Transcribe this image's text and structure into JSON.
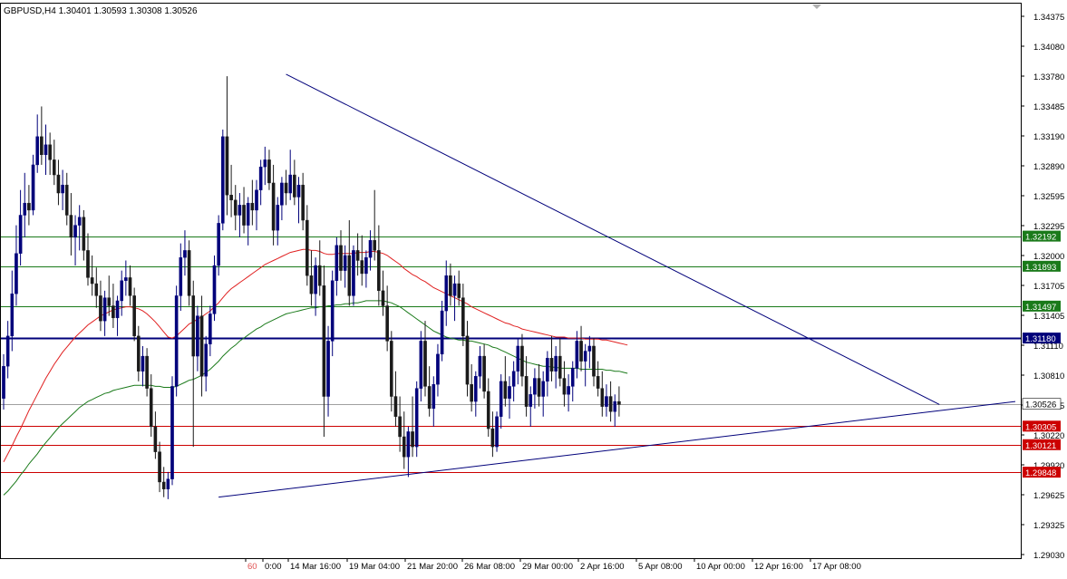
{
  "header": {
    "symbol": "GBPUSD,H4",
    "ohlc": "1.30401 1.30593 1.30308 1.30526"
  },
  "colors": {
    "background": "#ffffff",
    "bull_candle": "#00007a",
    "bear_candle": "#1a1a1a",
    "ma_fast": "#e02020",
    "ma_slow": "#1a7a1a",
    "support_level": "#cc0000",
    "resistance_level": "#1a7a1a",
    "pivot_level": "#00007a",
    "current_price": "#a0a0a0",
    "trendline": "#00007a"
  },
  "chart_data": {
    "type": "candlestick",
    "timeframe": "H4",
    "y_range": [
      1.289,
      1.345
    ],
    "y_ticks": [
      "1.34375",
      "1.34080",
      "1.33780",
      "1.33485",
      "1.33190",
      "1.32890",
      "1.32595",
      "1.32295",
      "1.32000",
      "1.31705",
      "1.31405",
      "1.31110",
      "1.30810",
      "1.30515",
      "1.30220",
      "1.29920",
      "1.29625",
      "1.29325",
      "1.29030"
    ],
    "x_labels": [
      "60",
      "0:00",
      "14 Mar 16:00",
      "19 Mar 04:00",
      "21 Mar 20:00",
      "26 Mar 08:00",
      "29 Mar 00:00",
      "2 Apr 16:00",
      "5 Apr 08:00",
      "10 Apr 00:00",
      "12 Apr 16:00",
      "17 Apr 08:00"
    ],
    "horizontal_levels": [
      {
        "price": 1.32192,
        "label": "1.32192",
        "kind": "resistance"
      },
      {
        "price": 1.31893,
        "label": "1.31893",
        "kind": "resistance"
      },
      {
        "price": 1.31497,
        "label": "1.31497",
        "kind": "resistance"
      },
      {
        "price": 1.3118,
        "label": "1.31180",
        "kind": "pivot"
      },
      {
        "price": 1.30526,
        "label": "1.30526",
        "kind": "current"
      },
      {
        "price": 1.30305,
        "label": "1.30305",
        "kind": "support"
      },
      {
        "price": 1.30121,
        "label": "1.30121",
        "kind": "support"
      },
      {
        "price": 1.29848,
        "label": "1.29848",
        "kind": "support"
      }
    ],
    "trendlines": [
      {
        "name": "descending",
        "from": {
          "bar": 67,
          "price": 1.338
        },
        "to": {
          "bar": 222,
          "price": 1.3052
        }
      },
      {
        "name": "ascending",
        "from": {
          "bar": 51,
          "price": 1.296
        },
        "to": {
          "bar": 240,
          "price": 1.3055
        }
      }
    ],
    "candles": [
      [
        1.3058,
        1.3102,
        1.3047,
        1.309
      ],
      [
        1.309,
        1.3135,
        1.3078,
        1.312
      ],
      [
        1.312,
        1.3185,
        1.3105,
        1.3162
      ],
      [
        1.3162,
        1.323,
        1.315,
        1.3202
      ],
      [
        1.3202,
        1.3265,
        1.319,
        1.324
      ],
      [
        1.324,
        1.3282,
        1.3218,
        1.3252
      ],
      [
        1.3252,
        1.327,
        1.323,
        1.3245
      ],
      [
        1.3245,
        1.33,
        1.324,
        1.329
      ],
      [
        1.329,
        1.334,
        1.3282,
        1.3318
      ],
      [
        1.3318,
        1.3348,
        1.329,
        1.33
      ],
      [
        1.33,
        1.333,
        1.328,
        1.331
      ],
      [
        1.331,
        1.3322,
        1.328,
        1.3295
      ],
      [
        1.3295,
        1.3315,
        1.327,
        1.328
      ],
      [
        1.328,
        1.3295,
        1.325,
        1.3262
      ],
      [
        1.3262,
        1.3285,
        1.3245,
        1.327
      ],
      [
        1.327,
        1.3282,
        1.323,
        1.324
      ],
      [
        1.324,
        1.3262,
        1.32,
        1.3218
      ],
      [
        1.3218,
        1.324,
        1.319,
        1.323
      ],
      [
        1.323,
        1.325,
        1.3205,
        1.3238
      ],
      [
        1.3238,
        1.3245,
        1.3195,
        1.3205
      ],
      [
        1.3205,
        1.3222,
        1.317,
        1.3178
      ],
      [
        1.3178,
        1.32,
        1.316,
        1.3172
      ],
      [
        1.3172,
        1.3188,
        1.3148,
        1.316
      ],
      [
        1.316,
        1.3175,
        1.3125,
        1.3135
      ],
      [
        1.3135,
        1.3165,
        1.312,
        1.3158
      ],
      [
        1.3158,
        1.318,
        1.314,
        1.315
      ],
      [
        1.315,
        1.3172,
        1.3128,
        1.3138
      ],
      [
        1.3138,
        1.316,
        1.312,
        1.3155
      ],
      [
        1.3155,
        1.3185,
        1.314,
        1.3175
      ],
      [
        1.3175,
        1.3195,
        1.316,
        1.3178
      ],
      [
        1.3178,
        1.319,
        1.315,
        1.316
      ],
      [
        1.316,
        1.3168,
        1.3115,
        1.312
      ],
      [
        1.312,
        1.313,
        1.3075,
        1.3085
      ],
      [
        1.3085,
        1.311,
        1.307,
        1.31
      ],
      [
        1.31,
        1.3108,
        1.306,
        1.3068
      ],
      [
        1.3068,
        1.3082,
        1.302,
        1.303
      ],
      [
        1.303,
        1.3045,
        1.2998,
        1.3005
      ],
      [
        1.3005,
        1.3015,
        1.2965,
        1.2975
      ],
      [
        1.2975,
        1.299,
        1.296,
        1.2968
      ],
      [
        1.2968,
        1.2985,
        1.2958,
        1.2978
      ],
      [
        1.2978,
        1.308,
        1.2972,
        1.307
      ],
      [
        1.307,
        1.317,
        1.306,
        1.316
      ],
      [
        1.316,
        1.3212,
        1.3145,
        1.3198
      ],
      [
        1.3198,
        1.3225,
        1.318,
        1.3205
      ],
      [
        1.3205,
        1.3215,
        1.315,
        1.316
      ],
      [
        1.316,
        1.3175,
        1.301,
        1.31
      ],
      [
        1.31,
        1.315,
        1.3085,
        1.314
      ],
      [
        1.314,
        1.316,
        1.306,
        1.308
      ],
      [
        1.308,
        1.312,
        1.3065,
        1.3112
      ],
      [
        1.3112,
        1.315,
        1.31,
        1.3142
      ],
      [
        1.3142,
        1.32,
        1.3135,
        1.319
      ],
      [
        1.319,
        1.324,
        1.318,
        1.3232
      ],
      [
        1.3232,
        1.3325,
        1.3225,
        1.3318
      ],
      [
        1.3318,
        1.3378,
        1.324,
        1.326
      ],
      [
        1.326,
        1.329,
        1.3238,
        1.3255
      ],
      [
        1.3255,
        1.327,
        1.3225,
        1.324
      ],
      [
        1.324,
        1.3262,
        1.3218,
        1.325
      ],
      [
        1.325,
        1.3268,
        1.3222,
        1.323
      ],
      [
        1.323,
        1.3258,
        1.321,
        1.3252
      ],
      [
        1.3252,
        1.3275,
        1.323,
        1.3245
      ],
      [
        1.3245,
        1.3275,
        1.3225,
        1.3265
      ],
      [
        1.3265,
        1.3295,
        1.325,
        1.3288
      ],
      [
        1.3288,
        1.3308,
        1.327,
        1.3295
      ],
      [
        1.3295,
        1.3305,
        1.3265,
        1.3272
      ],
      [
        1.3272,
        1.329,
        1.321,
        1.3225
      ],
      [
        1.3225,
        1.3258,
        1.321,
        1.325
      ],
      [
        1.325,
        1.3278,
        1.3235,
        1.3272
      ],
      [
        1.3272,
        1.3285,
        1.325,
        1.3262
      ],
      [
        1.3262,
        1.3305,
        1.3255,
        1.328
      ],
      [
        1.328,
        1.3295,
        1.325,
        1.3258
      ],
      [
        1.3258,
        1.3278,
        1.3232,
        1.327
      ],
      [
        1.327,
        1.3282,
        1.3225,
        1.3235
      ],
      [
        1.3235,
        1.325,
        1.317,
        1.318
      ],
      [
        1.318,
        1.3205,
        1.315,
        1.3162
      ],
      [
        1.3162,
        1.3198,
        1.314,
        1.319
      ],
      [
        1.319,
        1.3215,
        1.316,
        1.317
      ],
      [
        1.317,
        1.319,
        1.302,
        1.306
      ],
      [
        1.306,
        1.313,
        1.304,
        1.3115
      ],
      [
        1.3115,
        1.3185,
        1.31,
        1.3175
      ],
      [
        1.3175,
        1.3218,
        1.316,
        1.321
      ],
      [
        1.321,
        1.3225,
        1.3175,
        1.3185
      ],
      [
        1.3185,
        1.321,
        1.3168,
        1.32
      ],
      [
        1.32,
        1.3235,
        1.315,
        1.316
      ],
      [
        1.316,
        1.321,
        1.315,
        1.3205
      ],
      [
        1.3205,
        1.3222,
        1.318,
        1.3195
      ],
      [
        1.3195,
        1.322,
        1.317,
        1.3182
      ],
      [
        1.3182,
        1.3205,
        1.3168,
        1.3198
      ],
      [
        1.3198,
        1.3225,
        1.3185,
        1.3215
      ],
      [
        1.3215,
        1.3265,
        1.3195,
        1.3205
      ],
      [
        1.3205,
        1.323,
        1.315,
        1.3165
      ],
      [
        1.3165,
        1.3185,
        1.314,
        1.315
      ],
      [
        1.315,
        1.317,
        1.3105,
        1.3115
      ],
      [
        1.3115,
        1.3125,
        1.3045,
        1.306
      ],
      [
        1.306,
        1.3085,
        1.303,
        1.304
      ],
      [
        1.304,
        1.306,
        1.3005,
        1.302
      ],
      [
        1.302,
        1.3045,
        1.2988,
        1.3
      ],
      [
        1.3,
        1.303,
        1.298,
        1.3025
      ],
      [
        1.3025,
        1.306,
        1.3,
        1.301
      ],
      [
        1.301,
        1.3075,
        1.3,
        1.3068
      ],
      [
        1.3068,
        1.3125,
        1.3055,
        1.3115
      ],
      [
        1.3115,
        1.3135,
        1.306,
        1.307
      ],
      [
        1.307,
        1.309,
        1.304,
        1.3048
      ],
      [
        1.3048,
        1.308,
        1.303,
        1.3072
      ],
      [
        1.3072,
        1.3112,
        1.306,
        1.3102
      ],
      [
        1.3102,
        1.3155,
        1.3095,
        1.3145
      ],
      [
        1.3145,
        1.3195,
        1.313,
        1.318
      ],
      [
        1.318,
        1.3192,
        1.315,
        1.316
      ],
      [
        1.316,
        1.318,
        1.3135,
        1.3172
      ],
      [
        1.3172,
        1.3185,
        1.315,
        1.3158
      ],
      [
        1.3158,
        1.3172,
        1.311,
        1.312
      ],
      [
        1.312,
        1.3135,
        1.306,
        1.3072
      ],
      [
        1.3072,
        1.3092,
        1.3045,
        1.3055
      ],
      [
        1.3055,
        1.3085,
        1.304,
        1.308
      ],
      [
        1.308,
        1.311,
        1.3068,
        1.31
      ],
      [
        1.31,
        1.3112,
        1.3058,
        1.3065
      ],
      [
        1.3065,
        1.3078,
        1.302,
        1.3028
      ],
      [
        1.3028,
        1.3045,
        1.3,
        1.301
      ],
      [
        1.301,
        1.3045,
        1.3005,
        1.304
      ],
      [
        1.304,
        1.3082,
        1.3028,
        1.3075
      ],
      [
        1.3075,
        1.31,
        1.305,
        1.3058
      ],
      [
        1.3058,
        1.308,
        1.3038,
        1.307
      ],
      [
        1.307,
        1.3095,
        1.3055,
        1.3085
      ],
      [
        1.3085,
        1.3118,
        1.3072,
        1.311
      ],
      [
        1.311,
        1.3122,
        1.307,
        1.308
      ],
      [
        1.308,
        1.31,
        1.304,
        1.305
      ],
      [
        1.305,
        1.307,
        1.303,
        1.3062
      ],
      [
        1.3062,
        1.3088,
        1.3048,
        1.3078
      ],
      [
        1.3078,
        1.3092,
        1.305,
        1.306
      ],
      [
        1.306,
        1.3085,
        1.304,
        1.3075
      ],
      [
        1.3075,
        1.3105,
        1.306,
        1.3098
      ],
      [
        1.3098,
        1.312,
        1.3075,
        1.3085
      ],
      [
        1.3085,
        1.311,
        1.3068,
        1.31
      ],
      [
        1.31,
        1.3118,
        1.307,
        1.3078
      ],
      [
        1.3078,
        1.3095,
        1.305,
        1.3062
      ],
      [
        1.3062,
        1.3082,
        1.3045,
        1.307
      ],
      [
        1.307,
        1.3095,
        1.3055,
        1.3088
      ],
      [
        1.3088,
        1.3125,
        1.3078,
        1.3115
      ],
      [
        1.3115,
        1.313,
        1.3085,
        1.3095
      ],
      [
        1.3095,
        1.3112,
        1.307,
        1.3105
      ],
      [
        1.3105,
        1.312,
        1.3088,
        1.311
      ],
      [
        1.311,
        1.3118,
        1.307,
        1.308
      ],
      [
        1.308,
        1.3095,
        1.306,
        1.3068
      ],
      [
        1.3068,
        1.3085,
        1.304,
        1.305
      ],
      [
        1.305,
        1.3072,
        1.304,
        1.306
      ],
      [
        1.306,
        1.3075,
        1.3035,
        1.3045
      ],
      [
        1.3045,
        1.3062,
        1.303,
        1.3055
      ],
      [
        1.3055,
        1.307,
        1.304,
        1.3052
      ]
    ],
    "ma_fast": [
      1.2995,
      1.3003,
      1.3011,
      1.302,
      1.3028,
      1.3037,
      1.3046,
      1.3054,
      1.3062,
      1.307,
      1.3078,
      1.3085,
      1.3092,
      1.3098,
      1.3104,
      1.3109,
      1.3114,
      1.3119,
      1.3123,
      1.3127,
      1.3131,
      1.3134,
      1.3137,
      1.314,
      1.3142,
      1.3144,
      1.3146,
      1.3147,
      1.3148,
      1.3149,
      1.3149,
      1.3148,
      1.3147,
      1.3145,
      1.3142,
      1.3138,
      1.3134,
      1.3129,
      1.3124,
      1.3119,
      1.3118,
      1.312,
      1.3124,
      1.3128,
      1.3132,
      1.3134,
      1.3137,
      1.3139,
      1.3142,
      1.3145,
      1.3149,
      1.3153,
      1.3158,
      1.3163,
      1.3167,
      1.317,
      1.3173,
      1.3176,
      1.3179,
      1.3182,
      1.3185,
      1.3188,
      1.3191,
      1.3193,
      1.3195,
      1.3197,
      1.3199,
      1.3201,
      1.3203,
      1.3204,
      1.3205,
      1.3206,
      1.3206,
      1.3205,
      1.3205,
      1.3204,
      1.3202,
      1.3201,
      1.3201,
      1.3202,
      1.3202,
      1.3202,
      1.3202,
      1.3202,
      1.3203,
      1.3203,
      1.3203,
      1.3204,
      1.3204,
      1.3203,
      1.3202,
      1.32,
      1.3197,
      1.3194,
      1.3191,
      1.3187,
      1.3184,
      1.3181,
      1.3179,
      1.3176,
      1.3174,
      1.3171,
      1.3168,
      1.3166,
      1.3164,
      1.3162,
      1.316,
      1.3158,
      1.3156,
      1.3154,
      1.3152,
      1.3149,
      1.3147,
      1.3145,
      1.3143,
      1.3141,
      1.3139,
      1.3137,
      1.3135,
      1.3133,
      1.3132,
      1.313,
      1.3129,
      1.3127,
      1.3126,
      1.3125,
      1.3124,
      1.3123,
      1.3122,
      1.3121,
      1.312,
      1.3119,
      1.3119,
      1.3119,
      1.3118,
      1.3118,
      1.3118,
      1.3118,
      1.3117,
      1.3117,
      1.3117,
      1.3117,
      1.3116,
      1.3116,
      1.3115,
      1.3114,
      1.3113,
      1.3112,
      1.3111
    ],
    "ma_slow": [
      1.2962,
      1.2966,
      1.2971,
      1.2976,
      1.2982,
      1.2987,
      1.2993,
      1.2998,
      1.3003,
      1.3009,
      1.3014,
      1.3019,
      1.3024,
      1.3029,
      1.3033,
      1.3037,
      1.3041,
      1.3045,
      1.3049,
      1.3052,
      1.3055,
      1.3057,
      1.3059,
      1.3061,
      1.3063,
      1.3064,
      1.3066,
      1.3067,
      1.3068,
      1.3069,
      1.307,
      1.3071,
      1.3071,
      1.3071,
      1.3071,
      1.3071,
      1.307,
      1.307,
      1.3069,
      1.3069,
      1.3069,
      1.307,
      1.3072,
      1.3074,
      1.3076,
      1.3077,
      1.3079,
      1.3081,
      1.3084,
      1.3087,
      1.3091,
      1.3095,
      1.31,
      1.3104,
      1.3108,
      1.3111,
      1.3115,
      1.3118,
      1.3121,
      1.3124,
      1.3127,
      1.3129,
      1.3132,
      1.3134,
      1.3136,
      1.3138,
      1.314,
      1.3142,
      1.3143,
      1.3144,
      1.3145,
      1.3146,
      1.3147,
      1.3148,
      1.3148,
      1.3149,
      1.3149,
      1.315,
      1.315,
      1.3151,
      1.3151,
      1.3152,
      1.3152,
      1.3153,
      1.3153,
      1.3154,
      1.3155,
      1.3155,
      1.3155,
      1.3155,
      1.3155,
      1.3154,
      1.3153,
      1.3151,
      1.3149,
      1.3146,
      1.3143,
      1.314,
      1.3137,
      1.3134,
      1.3131,
      1.3128,
      1.3125,
      1.3123,
      1.3121,
      1.3119,
      1.3118,
      1.3117,
      1.3116,
      1.3116,
      1.3115,
      1.3115,
      1.3114,
      1.3113,
      1.3112,
      1.3111,
      1.3109,
      1.3108,
      1.3106,
      1.3104,
      1.3102,
      1.31,
      1.3098,
      1.3096,
      1.3094,
      1.3093,
      1.3092,
      1.3091,
      1.309,
      1.309,
      1.3089,
      1.3089,
      1.3088,
      1.3088,
      1.3088,
      1.3088,
      1.3088,
      1.3087,
      1.3087,
      1.3087,
      1.3087,
      1.3087,
      1.3087,
      1.3086,
      1.3086,
      1.3085,
      1.3085,
      1.3084,
      1.3083
    ]
  }
}
